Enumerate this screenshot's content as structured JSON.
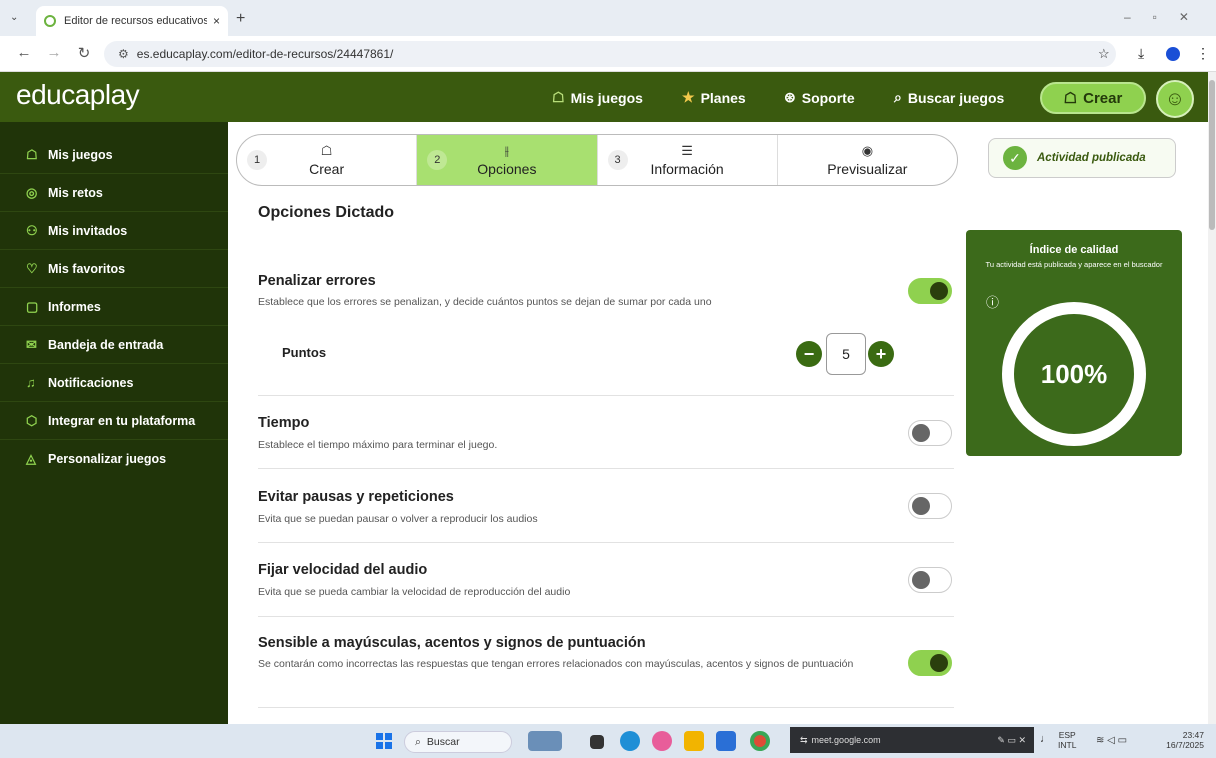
{
  "browser": {
    "tab_title": "Editor de recursos educativos: I",
    "tab_close": "×",
    "new_tab": "+",
    "url": "es.educaplay.com/editor-de-recursos/24447861/"
  },
  "header": {
    "logo": "educaplay",
    "links": [
      {
        "label": "Mis juegos",
        "icon": "☖"
      },
      {
        "label": "Planes",
        "icon": "★"
      },
      {
        "label": "Soporte",
        "icon": "⊛"
      },
      {
        "label": "Buscar juegos",
        "icon": "⌕"
      }
    ],
    "create_label": "Crear"
  },
  "sidebar": {
    "items": [
      {
        "label": "Mis juegos",
        "icon": "☖"
      },
      {
        "label": "Mis retos",
        "icon": "◎"
      },
      {
        "label": "Mis invitados",
        "icon": "⚇"
      },
      {
        "label": "Mis favoritos",
        "icon": "♡"
      },
      {
        "label": "Informes",
        "icon": "▢"
      },
      {
        "label": "Bandeja de entrada",
        "icon": "✉"
      },
      {
        "label": "Notificaciones",
        "icon": "♫"
      },
      {
        "label": "Integrar en tu plataforma",
        "icon": "⬡"
      },
      {
        "label": "Personalizar juegos",
        "icon": "◬"
      }
    ]
  },
  "stepper": {
    "steps": [
      {
        "num": "1",
        "label": "Crear",
        "icon": "☖"
      },
      {
        "num": "2",
        "label": "Opciones",
        "icon": "⫲"
      },
      {
        "num": "3",
        "label": "Información",
        "icon": "☰"
      },
      {
        "num": "",
        "label": "Previsualizar",
        "icon": "◉"
      }
    ],
    "active_index": 1
  },
  "published_label": "Actividad publicada",
  "main": {
    "section_title": "Opciones Dictado",
    "options": [
      {
        "title": "Penalizar errores",
        "desc": "Establece que los errores se penalizan, y decide cuántos puntos se dejan de sumar por cada uno",
        "on": true
      },
      {
        "title": "Tiempo",
        "desc": "Establece el tiempo máximo para terminar el juego.",
        "on": false
      },
      {
        "title": "Evitar pausas y repeticiones",
        "desc": "Evita que se puedan pausar o volver a reproducir los audios",
        "on": false
      },
      {
        "title": "Fijar velocidad del audio",
        "desc": "Evita que se pueda cambiar la velocidad de reproducción del audio",
        "on": false
      },
      {
        "title": "Sensible a mayúsculas, acentos y signos de puntuación",
        "desc": "Se contarán como incorrectas las respuestas que tengan errores relacionados con mayúsculas, acentos y signos de puntuación",
        "on": true
      }
    ],
    "puntos_label": "Puntos",
    "puntos_value": "5"
  },
  "quality": {
    "title": "Índice de calidad",
    "subtitle": "Tu actividad está publicada y aparece en el buscador",
    "value": "100%"
  },
  "taskbar": {
    "search_label": "Buscar",
    "meet_label": "meet.google.com",
    "lang": "ESP",
    "layout": "INTL",
    "time": "23:47",
    "date": "16/7/2025"
  },
  "colors": {
    "brand_dark": "#3a5a0f",
    "brand_light": "#8fd14f",
    "sidebar": "#203409"
  }
}
